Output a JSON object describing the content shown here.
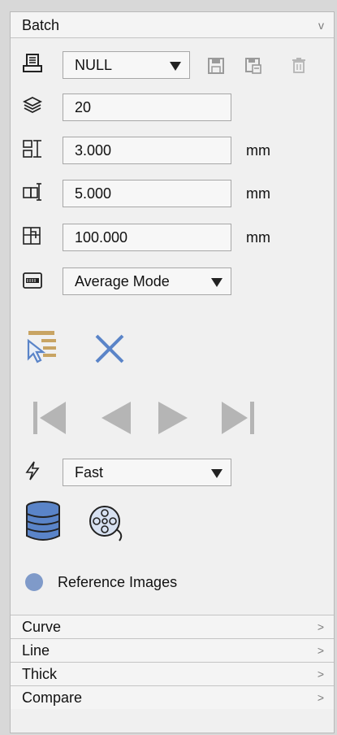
{
  "batch": {
    "title": "Batch",
    "chevron": "v",
    "printer_select": "NULL",
    "layers_value": "20",
    "spacing_x": "3.000",
    "spacing_x_unit": "mm",
    "spacing_y": "5.000",
    "spacing_y_unit": "mm",
    "area": "100.000",
    "area_unit": "mm",
    "mode_select": "Average Mode",
    "speed_select": "Fast",
    "reference_label": "Reference Images"
  },
  "sections": [
    {
      "label": "Curve",
      "chevron": ">"
    },
    {
      "label": "Line",
      "chevron": ">"
    },
    {
      "label": "Thick",
      "chevron": ">"
    },
    {
      "label": "Compare",
      "chevron": ">"
    }
  ],
  "colors": {
    "accent": "#5a84c8",
    "reference_dot": "#7f9ac9",
    "disabled": "#b5b5b5"
  }
}
